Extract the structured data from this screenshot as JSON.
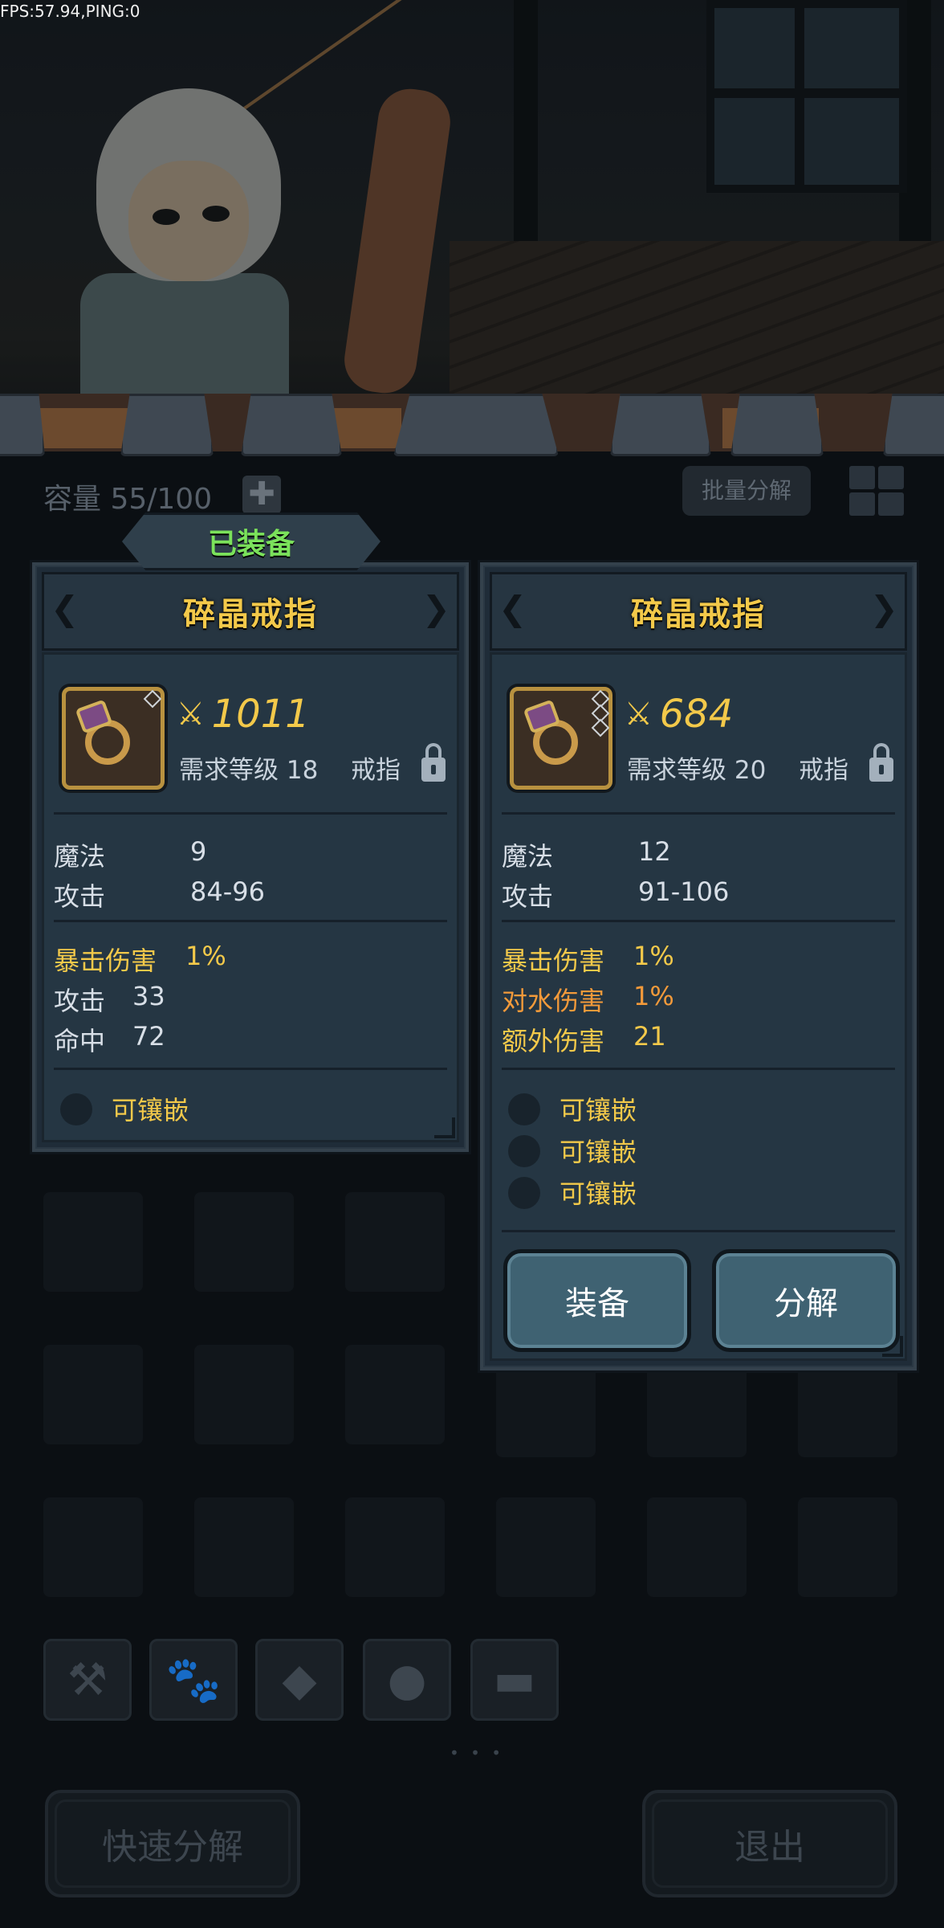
{
  "debug": {
    "fps_text": "FPS:57.94,PING:0"
  },
  "inventory": {
    "capacity_text": "容量 55/100",
    "batch_label": "批量分解",
    "quick_salvage_label": "快速分解",
    "exit_label": "退出",
    "category_icons": [
      "weapon-icon",
      "paw-icon",
      "gem-icon",
      "material-icon",
      "chest-icon"
    ]
  },
  "equipped_item": {
    "tag": "已装备",
    "name": "碎晶戒指",
    "score": "1011",
    "req_text": "需求等级 18",
    "type": "戒指",
    "base_stats": [
      {
        "label": "魔法",
        "value": "9"
      },
      {
        "label": "攻击",
        "value": "84-96"
      }
    ],
    "extra_stats": [
      {
        "label": "暴击伤害",
        "value": "1%",
        "color": "#f3c94a"
      },
      {
        "label": "攻击",
        "value": "33",
        "color": "#d8dfe7"
      },
      {
        "label": "命中",
        "value": "72",
        "color": "#d8dfe7"
      }
    ],
    "sockets": [
      "可镶嵌"
    ]
  },
  "selected_item": {
    "name": "碎晶戒指",
    "score": "684",
    "req_text": "需求等级 20",
    "type": "戒指",
    "base_stats": [
      {
        "label": "魔法",
        "value": "12"
      },
      {
        "label": "攻击",
        "value": "91-106"
      }
    ],
    "extra_stats": [
      {
        "label": "暴击伤害",
        "value": "1%",
        "color": "#f3c94a"
      },
      {
        "label": "对水伤害",
        "value": "1%",
        "color": "#f39a3a"
      },
      {
        "label": "额外伤害",
        "value": "21",
        "color": "#f3c94a"
      }
    ],
    "sockets": [
      "可镶嵌",
      "可镶嵌",
      "可镶嵌"
    ],
    "equip_label": "装备",
    "salvage_label": "分解"
  },
  "colors": {
    "accent_gold": "#f3c94a",
    "equipped_green": "#7be25b",
    "button_teal": "#3f6272"
  }
}
